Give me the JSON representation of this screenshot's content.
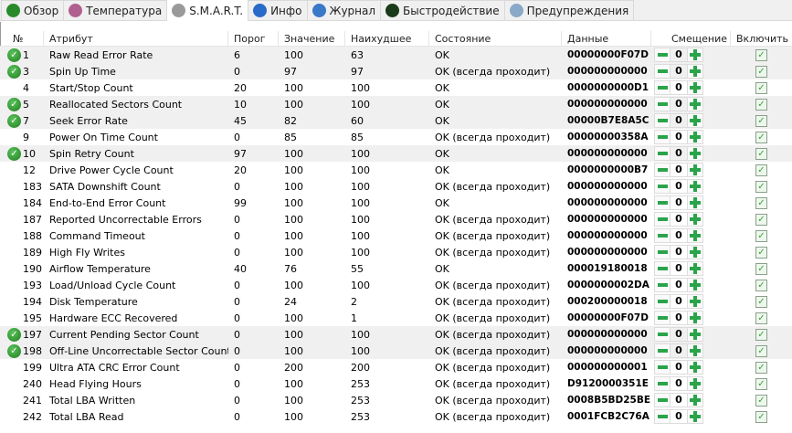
{
  "tabs": [
    {
      "label": "Обзор",
      "icon": "check-circle-icon",
      "color": "#2a8a2a"
    },
    {
      "label": "Температура",
      "icon": "thermometer-icon",
      "color": "#b06090"
    },
    {
      "label": "S.M.A.R.T.",
      "icon": "disk-icon",
      "color": "#9a9a9a",
      "active": true
    },
    {
      "label": "Инфо",
      "icon": "info-icon",
      "color": "#2a6ac8"
    },
    {
      "label": "Журнал",
      "icon": "log-icon",
      "color": "#3a78c8"
    },
    {
      "label": "Быстродействие",
      "icon": "gauge-icon",
      "color": "#1a3a1a"
    },
    {
      "label": "Предупреждения",
      "icon": "warning-doc-icon",
      "color": "#8aa8c8"
    }
  ],
  "columns": {
    "num": "№",
    "attr": "Атрибут",
    "threshold": "Порог",
    "value": "Значение",
    "worst": "Наихудшее",
    "state": "Состояние",
    "data": "Данные",
    "offset": "Смещение",
    "enable": "Включить"
  },
  "rows": [
    {
      "num": "1",
      "attr": "Raw Read Error Rate",
      "thr": "6",
      "val": "100",
      "worst": "63",
      "state": "OK",
      "data": "00000000F07D",
      "off": "0",
      "crit": true
    },
    {
      "num": "3",
      "attr": "Spin Up Time",
      "thr": "0",
      "val": "97",
      "worst": "97",
      "state": "OK (всегда проходит)",
      "data": "000000000000",
      "off": "0",
      "crit": true
    },
    {
      "num": "4",
      "attr": "Start/Stop Count",
      "thr": "20",
      "val": "100",
      "worst": "100",
      "state": "OK",
      "data": "0000000000D1",
      "off": "0",
      "crit": false
    },
    {
      "num": "5",
      "attr": "Reallocated Sectors Count",
      "thr": "10",
      "val": "100",
      "worst": "100",
      "state": "OK",
      "data": "000000000000",
      "off": "0",
      "crit": true
    },
    {
      "num": "7",
      "attr": "Seek Error Rate",
      "thr": "45",
      "val": "82",
      "worst": "60",
      "state": "OK",
      "data": "00000B7E8A5C",
      "off": "0",
      "crit": true
    },
    {
      "num": "9",
      "attr": "Power On Time Count",
      "thr": "0",
      "val": "85",
      "worst": "85",
      "state": "OK (всегда проходит)",
      "data": "00000000358A",
      "off": "0",
      "crit": false
    },
    {
      "num": "10",
      "attr": "Spin Retry Count",
      "thr": "97",
      "val": "100",
      "worst": "100",
      "state": "OK",
      "data": "000000000000",
      "off": "0",
      "crit": true
    },
    {
      "num": "12",
      "attr": "Drive Power Cycle Count",
      "thr": "20",
      "val": "100",
      "worst": "100",
      "state": "OK",
      "data": "0000000000B7",
      "off": "0",
      "crit": false
    },
    {
      "num": "183",
      "attr": "SATA Downshift Count",
      "thr": "0",
      "val": "100",
      "worst": "100",
      "state": "OK (всегда проходит)",
      "data": "000000000000",
      "off": "0",
      "crit": false
    },
    {
      "num": "184",
      "attr": "End-to-End Error Count",
      "thr": "99",
      "val": "100",
      "worst": "100",
      "state": "OK",
      "data": "000000000000",
      "off": "0",
      "crit": false
    },
    {
      "num": "187",
      "attr": "Reported Uncorrectable Errors",
      "thr": "0",
      "val": "100",
      "worst": "100",
      "state": "OK (всегда проходит)",
      "data": "000000000000",
      "off": "0",
      "crit": false
    },
    {
      "num": "188",
      "attr": "Command Timeout",
      "thr": "0",
      "val": "100",
      "worst": "100",
      "state": "OK (всегда проходит)",
      "data": "000000000000",
      "off": "0",
      "crit": false
    },
    {
      "num": "189",
      "attr": "High Fly Writes",
      "thr": "0",
      "val": "100",
      "worst": "100",
      "state": "OK (всегда проходит)",
      "data": "000000000000",
      "off": "0",
      "crit": false
    },
    {
      "num": "190",
      "attr": "Airflow Temperature",
      "thr": "40",
      "val": "76",
      "worst": "55",
      "state": "OK",
      "data": "000019180018",
      "off": "0",
      "crit": false
    },
    {
      "num": "193",
      "attr": "Load/Unload Cycle Count",
      "thr": "0",
      "val": "100",
      "worst": "100",
      "state": "OK (всегда проходит)",
      "data": "0000000002DA",
      "off": "0",
      "crit": false
    },
    {
      "num": "194",
      "attr": "Disk Temperature",
      "thr": "0",
      "val": "24",
      "worst": "2",
      "state": "OK (всегда проходит)",
      "data": "000200000018",
      "off": "0",
      "crit": false
    },
    {
      "num": "195",
      "attr": "Hardware ECC Recovered",
      "thr": "0",
      "val": "100",
      "worst": "1",
      "state": "OK (всегда проходит)",
      "data": "00000000F07D",
      "off": "0",
      "crit": false
    },
    {
      "num": "197",
      "attr": "Current Pending Sector Count",
      "thr": "0",
      "val": "100",
      "worst": "100",
      "state": "OK (всегда проходит)",
      "data": "000000000000",
      "off": "0",
      "crit": true
    },
    {
      "num": "198",
      "attr": "Off-Line Uncorrectable Sector Count",
      "thr": "0",
      "val": "100",
      "worst": "100",
      "state": "OK (всегда проходит)",
      "data": "000000000000",
      "off": "0",
      "crit": true
    },
    {
      "num": "199",
      "attr": "Ultra ATA CRC Error Count",
      "thr": "0",
      "val": "200",
      "worst": "200",
      "state": "OK (всегда проходит)",
      "data": "000000000001",
      "off": "0",
      "crit": false
    },
    {
      "num": "240",
      "attr": "Head Flying Hours",
      "thr": "0",
      "val": "100",
      "worst": "253",
      "state": "OK (всегда проходит)",
      "data": "D9120000351E",
      "off": "0",
      "crit": false
    },
    {
      "num": "241",
      "attr": "Total LBA Written",
      "thr": "0",
      "val": "100",
      "worst": "253",
      "state": "OK (всегда проходит)",
      "data": "0008B5BD25BE",
      "off": "0",
      "crit": false
    },
    {
      "num": "242",
      "attr": "Total LBA Read",
      "thr": "0",
      "val": "100",
      "worst": "253",
      "state": "OK (всегда проходит)",
      "data": "0001FCB2C76A",
      "off": "0",
      "crit": false
    }
  ]
}
